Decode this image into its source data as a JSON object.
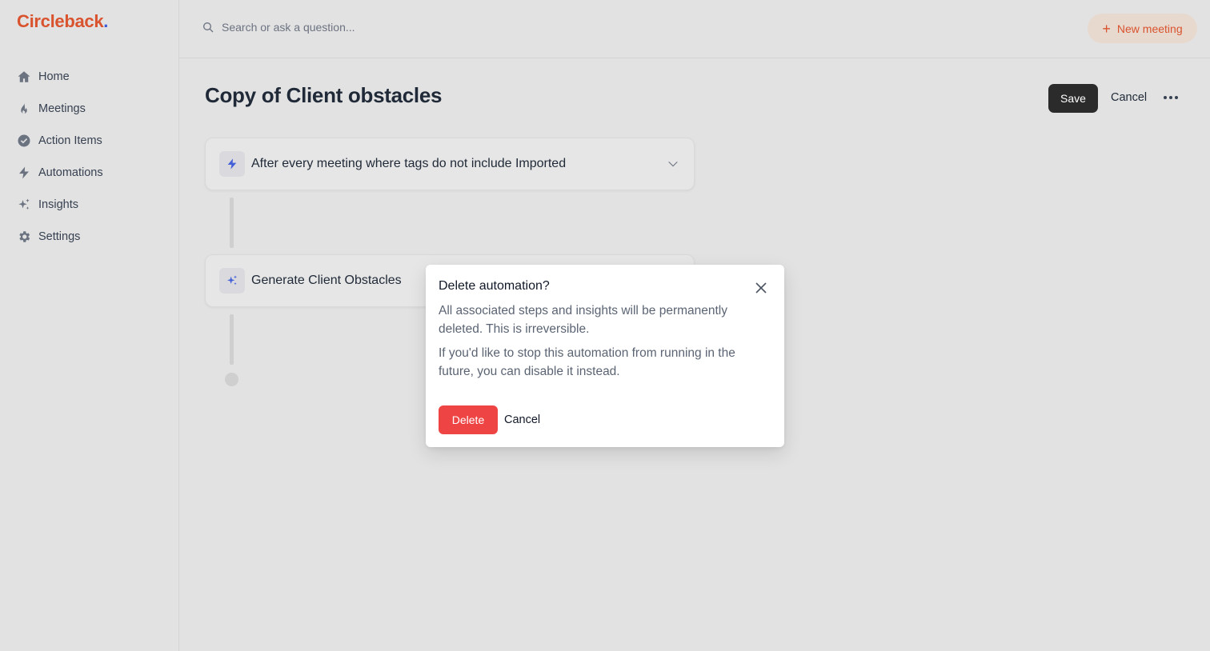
{
  "app": {
    "name": "Circleback",
    "name_dot": ".",
    "brand_color": "#d9532e",
    "dot_color": "#3b5bdb"
  },
  "sidebar": {
    "items": [
      {
        "label": "Home",
        "icon": "home-icon"
      },
      {
        "label": "Meetings",
        "icon": "flame-icon"
      },
      {
        "label": "Action Items",
        "icon": "check-circle-icon"
      },
      {
        "label": "Automations",
        "icon": "bolt-icon"
      },
      {
        "label": "Insights",
        "icon": "sparkles-icon"
      },
      {
        "label": "Settings",
        "icon": "gear-icon"
      }
    ]
  },
  "topbar": {
    "search_placeholder": "Search or ask a question...",
    "new_meeting_label": "New meeting"
  },
  "page": {
    "title": "Copy of Client obstacles",
    "save_label": "Save",
    "cancel_label": "Cancel"
  },
  "steps": [
    {
      "label": "After every meeting where tags do not include Imported",
      "icon": "bolt-icon"
    },
    {
      "label": "Generate Client Obstacles",
      "icon": "sparkles-icon"
    }
  ],
  "modal": {
    "title": "Delete automation?",
    "paragraph_1": "All associated steps and insights will be permanently deleted. This is irreversible.",
    "paragraph_2": "If you'd like to stop this automation from running in the future, you can disable it instead.",
    "delete_label": "Delete",
    "cancel_label": "Cancel",
    "danger_color": "#ef4444"
  }
}
